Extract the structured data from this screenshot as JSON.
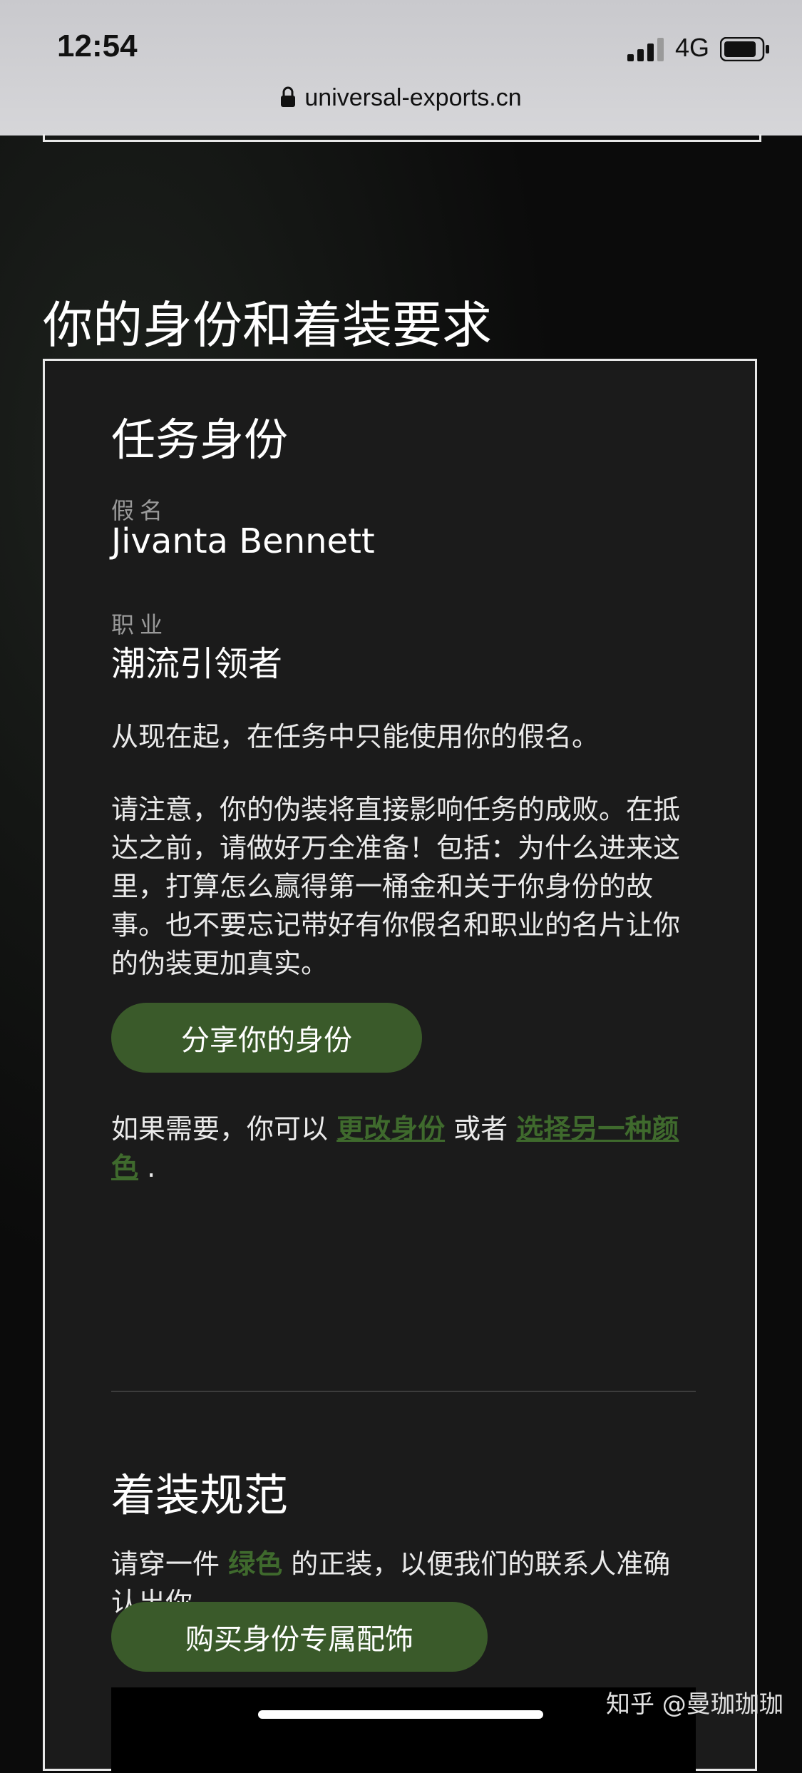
{
  "status_bar": {
    "time": "12:54",
    "network": "4G",
    "url": "universal-exports.cn"
  },
  "page": {
    "section_heading": "你的身份和着装要求",
    "identity": {
      "title": "任务身份",
      "alias_label": "假名",
      "alias_value": "Jivanta Bennett",
      "job_label": "职业",
      "job_value": "潮流引领者",
      "para1": "从现在起，在任务中只能使用你的假名。",
      "para2": "请注意，你的伪装将直接影响任务的成败。在抵达之前，请做好万全准备！包括：为什么进来这里，打算怎么赢得第一桶金和关于你身份的故事。也不要忘记带好有你假名和职业的名片让你的伪装更加真实。",
      "share_button": "分享你的身份",
      "change_prefix": "如果需要，你可以",
      "change_link": "更改身份",
      "change_middle": "或者",
      "color_link": "选择另一种颜色",
      "change_suffix": "."
    },
    "dress": {
      "title": "着装规范",
      "text_prefix": "请穿一件",
      "color_word": "绿色",
      "text_suffix": "的正装，以便我们的联系人准确认出你。",
      "buy_button": "购买身份专属配饰"
    }
  },
  "watermark": "知乎 @曼珈珈珈",
  "colors": {
    "accent_green": "#3a5a2a",
    "link_green": "#3f6a2d",
    "card_bg": "#1b1b1b"
  }
}
